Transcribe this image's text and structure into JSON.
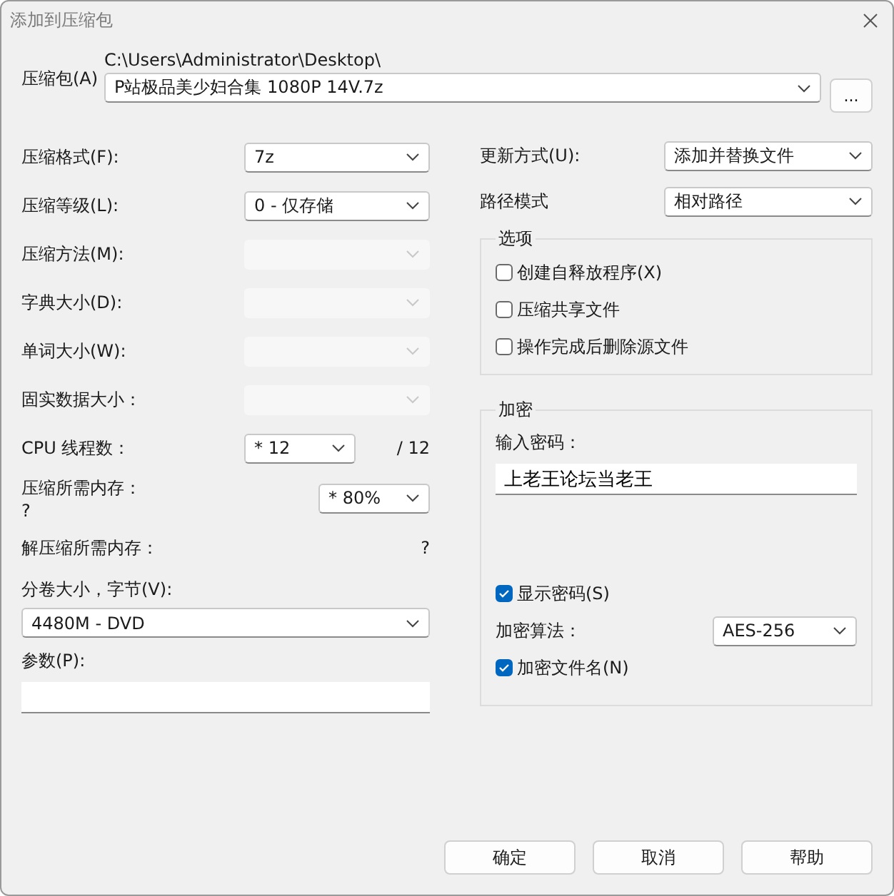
{
  "window": {
    "title": "添加到压缩包"
  },
  "archive": {
    "label": "压缩包(A)",
    "path": "C:\\Users\\Administrator\\Desktop\\",
    "filename": "P站极品美少妇合集 1080P 14V.7z",
    "browse": "..."
  },
  "fields": [
    {
      "label": "压缩格式(F):",
      "value": "7z",
      "disabled": false
    },
    {
      "label": "压缩等级(L):",
      "value": "0 - 仅存储",
      "disabled": false
    },
    {
      "label": "压缩方法(M):",
      "disabled": true
    },
    {
      "label": "字典大小(D):",
      "disabled": true
    },
    {
      "label": "单词大小(W):",
      "disabled": true
    },
    {
      "label": "固实数据大小：",
      "disabled": true
    }
  ],
  "cpu": {
    "label": "CPU 线程数：",
    "value": "* 12",
    "total": "/ 12"
  },
  "memory": {
    "label": "压缩所需内存：",
    "note": "?",
    "value": "* 80%"
  },
  "decompress": {
    "label": "解压缩所需内存：",
    "value": "?"
  },
  "volume": {
    "label": "分卷大小，字节(V):",
    "value": "4480M - DVD"
  },
  "params": {
    "label": "参数(P):"
  },
  "right_fields": [
    {
      "label": "更新方式(U):",
      "value": "添加并替换文件"
    },
    {
      "label": "路径模式",
      "value": "相对路径"
    }
  ],
  "options": {
    "title": "选项",
    "items": [
      {
        "label": "创建自释放程序(X)",
        "checked": false
      },
      {
        "label": "压缩共享文件",
        "checked": false
      },
      {
        "label": "操作完成后删除源文件",
        "checked": false
      }
    ]
  },
  "encryption": {
    "title": "加密",
    "password_label": "输入密码：",
    "password": "上老王论坛当老王",
    "show_password": {
      "label": "显示密码(S)",
      "checked": true
    },
    "method_label": "加密算法：",
    "method": "AES-256",
    "encrypt_names": {
      "label": "加密文件名(N)",
      "checked": true
    }
  },
  "buttons": [
    "确定",
    "取消",
    "帮助"
  ]
}
